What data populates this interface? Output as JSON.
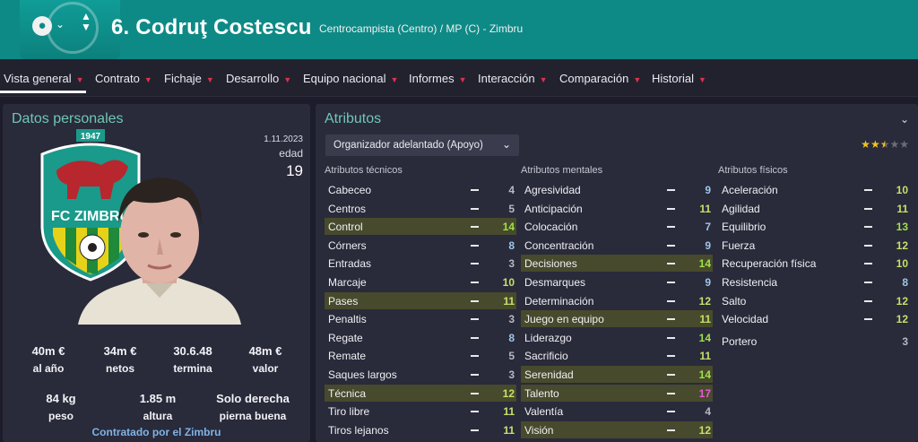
{
  "header": {
    "player_name": "6. Codruţ Costescu",
    "role_line": "Centrocampista (Centro) / MP (C) - Zimbru",
    "colors": {
      "header_bg": "#0e8a86",
      "accent_red": "#e0304a",
      "title_green": "#6fc7b4"
    }
  },
  "nav": {
    "items": [
      {
        "label": "Vista general"
      },
      {
        "label": "Contrato"
      },
      {
        "label": "Fichaje"
      },
      {
        "label": "Desarrollo"
      },
      {
        "label": "Equipo nacional"
      },
      {
        "label": "Informes"
      },
      {
        "label": "Interacción"
      },
      {
        "label": "Comparación"
      },
      {
        "label": "Historial"
      }
    ]
  },
  "personal": {
    "title": "Datos personales",
    "date": "1.11.2023",
    "age_label": "edad",
    "age": "19",
    "stats": [
      {
        "value": "40m €",
        "label": "al año"
      },
      {
        "value": "34m €",
        "label": "netos"
      },
      {
        "value": "30.6.48",
        "label": "termina"
      },
      {
        "value": "48m €",
        "label": "valor"
      },
      {
        "value": "84 kg",
        "label": "peso"
      },
      {
        "value": "1.85 m",
        "label": "altura"
      },
      {
        "value": "Solo derecha",
        "label": "pierna buena"
      }
    ],
    "contract_text": "Contratado por el Zimbru"
  },
  "attributes": {
    "title": "Atributos",
    "role_select": "Organizador adelantado (Apoyo)",
    "rating_stars": 2.5,
    "technical": {
      "title": "Atributos técnicos",
      "items": [
        {
          "name": "Cabeceo",
          "value": "4"
        },
        {
          "name": "Centros",
          "value": "5"
        },
        {
          "name": "Control",
          "value": "14",
          "key": true
        },
        {
          "name": "Córners",
          "value": "8"
        },
        {
          "name": "Entradas",
          "value": "3"
        },
        {
          "name": "Marcaje",
          "value": "10"
        },
        {
          "name": "Pases",
          "value": "11",
          "key": true
        },
        {
          "name": "Penaltis",
          "value": "3"
        },
        {
          "name": "Regate",
          "value": "8"
        },
        {
          "name": "Remate",
          "value": "5"
        },
        {
          "name": "Saques largos",
          "value": "3"
        },
        {
          "name": "Técnica",
          "value": "12",
          "key": true
        },
        {
          "name": "Tiro libre",
          "value": "11"
        },
        {
          "name": "Tiros lejanos",
          "value": "11"
        }
      ]
    },
    "mental": {
      "title": "Atributos mentales",
      "items": [
        {
          "name": "Agresividad",
          "value": "9"
        },
        {
          "name": "Anticipación",
          "value": "11"
        },
        {
          "name": "Colocación",
          "value": "7"
        },
        {
          "name": "Concentración",
          "value": "9"
        },
        {
          "name": "Decisiones",
          "value": "14",
          "key": true
        },
        {
          "name": "Desmarques",
          "value": "9"
        },
        {
          "name": "Determinación",
          "value": "12"
        },
        {
          "name": "Juego en equipo",
          "value": "11",
          "key": true
        },
        {
          "name": "Liderazgo",
          "value": "14"
        },
        {
          "name": "Sacrificio",
          "value": "11"
        },
        {
          "name": "Serenidad",
          "value": "14",
          "key": true
        },
        {
          "name": "Talento",
          "value": "17",
          "key": true
        },
        {
          "name": "Valentía",
          "value": "4"
        },
        {
          "name": "Visión",
          "value": "12",
          "key": true
        }
      ]
    },
    "physical": {
      "title": "Atributos físicos",
      "items": [
        {
          "name": "Aceleración",
          "value": "10"
        },
        {
          "name": "Agilidad",
          "value": "11"
        },
        {
          "name": "Equilibrio",
          "value": "13"
        },
        {
          "name": "Fuerza",
          "value": "12"
        },
        {
          "name": "Recuperación física",
          "value": "10"
        },
        {
          "name": "Resistencia",
          "value": "8"
        },
        {
          "name": "Salto",
          "value": "12"
        },
        {
          "name": "Velocidad",
          "value": "12"
        }
      ],
      "goalkeeper": {
        "name": "Portero",
        "value": "3"
      }
    }
  }
}
